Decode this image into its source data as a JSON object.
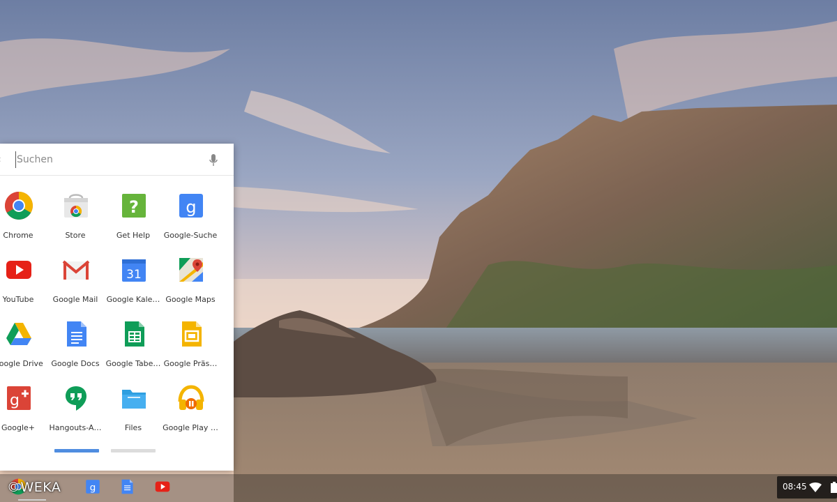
{
  "search": {
    "placeholder": "Suchen"
  },
  "apps": [
    {
      "label": "Chrome",
      "icon": "chrome-icon"
    },
    {
      "label": "Store",
      "icon": "web-store-icon"
    },
    {
      "label": "Get Help",
      "icon": "get-help-icon"
    },
    {
      "label": "Google-Suche",
      "icon": "google-search-icon"
    },
    {
      "label": "YouTube",
      "icon": "youtube-icon"
    },
    {
      "label": "Google Mail",
      "icon": "gmail-icon"
    },
    {
      "label": "Google Kale…",
      "icon": "google-calendar-icon",
      "icon_text": "31"
    },
    {
      "label": "Google Maps",
      "icon": "google-maps-icon"
    },
    {
      "label": "Google Drive",
      "icon": "google-drive-icon"
    },
    {
      "label": "Google Docs",
      "icon": "google-docs-icon"
    },
    {
      "label": "Google Tabe…",
      "icon": "google-sheets-icon"
    },
    {
      "label": "Google Präs…",
      "icon": "google-slides-icon"
    },
    {
      "label": "Google+",
      "icon": "google-plus-icon"
    },
    {
      "label": "Hangouts-A…",
      "icon": "hangouts-icon"
    },
    {
      "label": "Files",
      "icon": "files-icon"
    },
    {
      "label": "Google Play …",
      "icon": "google-play-music-icon"
    }
  ],
  "pager": {
    "pages": 2,
    "active": 1
  },
  "shelf": {
    "watermark": "©WEKA",
    "pinned": [
      "chrome-icon",
      "google-search-icon",
      "google-docs-icon",
      "youtube-icon"
    ]
  },
  "tray": {
    "time": "08:45"
  },
  "colors": {
    "accent": "#4f8de0",
    "youtube": "#e62117",
    "google_blue": "#4285f4",
    "google_green": "#0f9d58",
    "google_yellow": "#f4b400",
    "google_red": "#db4437"
  }
}
